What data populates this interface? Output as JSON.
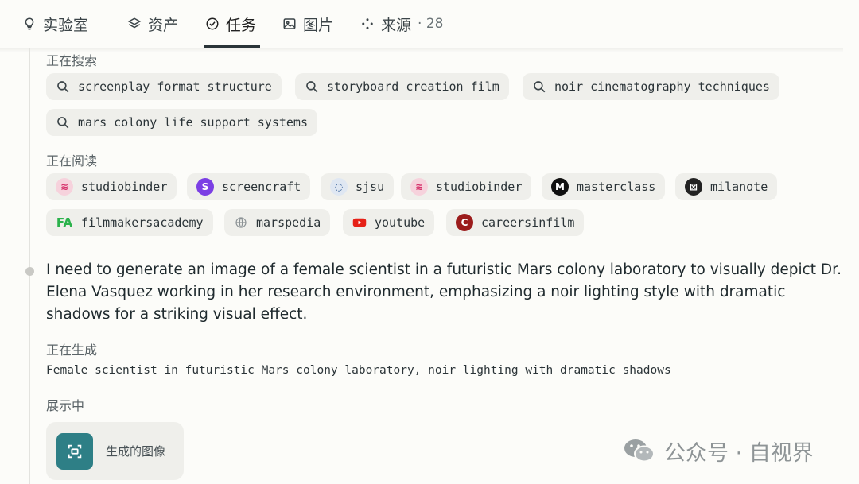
{
  "tabs": [
    {
      "label": "实验室",
      "icon": "lightbulb-icon"
    },
    {
      "label": "资产",
      "icon": "layers-icon"
    },
    {
      "label": "任务",
      "icon": "check-circle-icon",
      "active": true
    },
    {
      "label": "图片",
      "icon": "image-icon"
    },
    {
      "label": "来源",
      "icon": "sources-icon",
      "count": "· 28"
    }
  ],
  "searching": {
    "label": "正在搜索",
    "queries": [
      "screenplay format structure",
      "storyboard creation film",
      "noir cinematography techniques",
      "mars colony life support systems"
    ]
  },
  "reading": {
    "label": "正在阅读",
    "sources": [
      {
        "name": "studiobinder",
        "icon": "studiobinder-icon"
      },
      {
        "name": "screencraft",
        "icon": "screencraft-icon"
      },
      {
        "name": "sjsu",
        "icon": "sjsu-icon"
      },
      {
        "name": "studiobinder",
        "icon": "studiobinder-icon"
      },
      {
        "name": "masterclass",
        "icon": "masterclass-icon"
      },
      {
        "name": "milanote",
        "icon": "milanote-icon"
      },
      {
        "name": "filmmakersacademy",
        "icon": "filmmakersacademy-icon"
      },
      {
        "name": "marspedia",
        "icon": "globe-icon"
      },
      {
        "name": "youtube",
        "icon": "youtube-icon"
      },
      {
        "name": "careersinfilm",
        "icon": "careersinfilm-icon"
      }
    ]
  },
  "message": "I need to generate an image of a female scientist in a futuristic Mars colony laboratory to visually depict Dr. Elena Vasquez working in her research environment, emphasizing a noir lighting style with dramatic shadows for a striking visual effect.",
  "generating": {
    "label": "正在生成",
    "prompt": "Female scientist in futuristic Mars colony laboratory, noir lighting with dramatic shadows"
  },
  "showing": {
    "label": "展示中",
    "card_label": "生成的图像"
  },
  "watermark": {
    "text": "公众号 · 自视界",
    "icon": "wechat-icon"
  },
  "colors": {
    "accent_teal": "#2e7f86",
    "chip_bg": "#efefeb",
    "page_bg": "#fcfcf9"
  }
}
